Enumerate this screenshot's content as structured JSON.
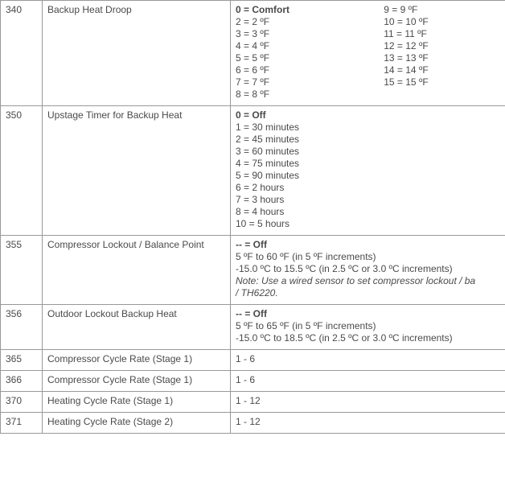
{
  "rows": [
    {
      "id": "340",
      "name": "Backup Heat Droop",
      "values": {
        "headL": "0 = Comfort",
        "headR": "9 = 9 ºF",
        "left": [
          "2 = 2 ºF",
          "3 = 3 ºF",
          "4 = 4 ºF",
          "5 = 5 ºF",
          "6 = 6 ºF",
          "7 = 7 ºF",
          "8 = 8 ºF"
        ],
        "right": [
          "10 = 10 ºF",
          "11 = 11 ºF",
          "12 = 12 ºF",
          "13 = 13 ºF",
          "14 = 14 ºF",
          "15 = 15 ºF"
        ]
      }
    },
    {
      "id": "350",
      "name": "Upstage Timer for Backup Heat",
      "values": {
        "head": "0 = Off",
        "lines": [
          "1 = 30 minutes",
          "2 = 45 minutes",
          "3 = 60 minutes",
          "4 = 75 minutes",
          "5 = 90 minutes",
          "6 = 2 hours",
          "7 = 3 hours",
          "8 = 4 hours",
          "10 = 5 hours"
        ]
      }
    },
    {
      "id": "355",
      "name": "Compressor Lockout / Balance Point",
      "values": {
        "head": "-- = Off",
        "lines": [
          "5 ºF to 60 ºF (in 5 ºF increments)",
          "-15.0 ºC to 15.5 ºC (in 2.5 ºC or 3.0 ºC increments)"
        ],
        "noteLines": [
          "Note: Use a wired sensor to set compressor lockout / ba",
          "/ TH6220."
        ]
      }
    },
    {
      "id": "356",
      "name": "Outdoor Lockout Backup Heat",
      "values": {
        "head": "-- = Off",
        "lines": [
          "5 ºF to 65 ºF (in 5 ºF increments)",
          "-15.0 ºC to 18.5 ºC (in 2.5 ºC or 3.0 ºC increments)"
        ]
      }
    },
    {
      "id": "365",
      "name": "Compressor Cycle Rate (Stage 1)",
      "values": {
        "text": "1 - 6"
      }
    },
    {
      "id": "366",
      "name": "Compressor Cycle Rate (Stage 1)",
      "values": {
        "text": "1 - 6"
      }
    },
    {
      "id": "370",
      "name": "Heating Cycle Rate (Stage 1)",
      "values": {
        "text": "1 - 12"
      }
    },
    {
      "id": "371",
      "name": "Heating Cycle Rate (Stage 2)",
      "values": {
        "text": "1 - 12"
      }
    }
  ]
}
